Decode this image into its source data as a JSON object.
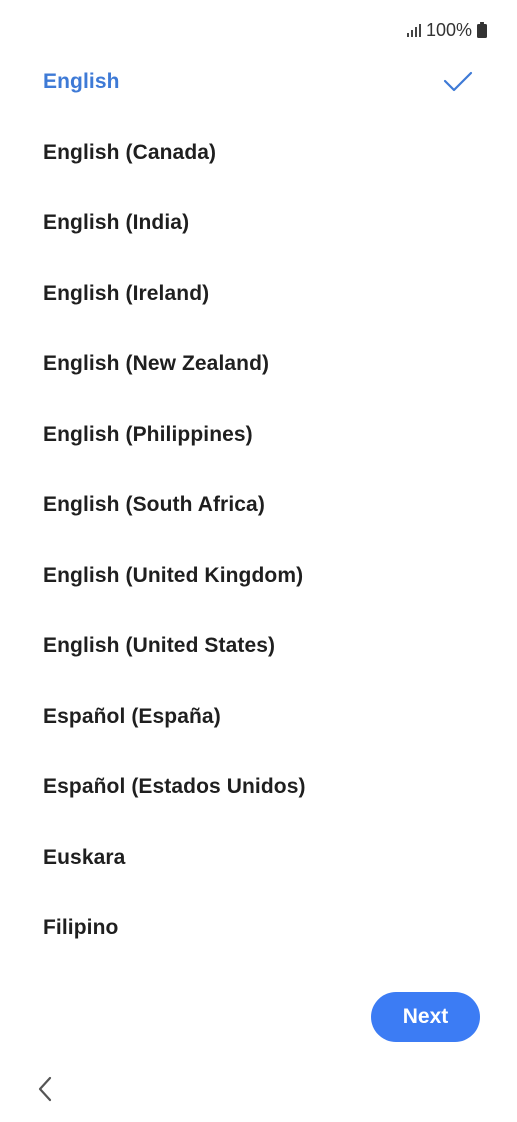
{
  "status_bar": {
    "signal_icon": "signal-bars-icon",
    "battery_text": "100%",
    "battery_icon": "battery-full-icon"
  },
  "languages": [
    {
      "label": "English",
      "selected": true
    },
    {
      "label": "English (Canada)",
      "selected": false
    },
    {
      "label": "English (India)",
      "selected": false
    },
    {
      "label": "English (Ireland)",
      "selected": false
    },
    {
      "label": "English (New Zealand)",
      "selected": false
    },
    {
      "label": "English (Philippines)",
      "selected": false
    },
    {
      "label": "English (South Africa)",
      "selected": false
    },
    {
      "label": "English (United Kingdom)",
      "selected": false
    },
    {
      "label": "English (United States)",
      "selected": false
    },
    {
      "label": "Español (España)",
      "selected": false
    },
    {
      "label": "Español (Estados Unidos)",
      "selected": false
    },
    {
      "label": "Euskara",
      "selected": false
    },
    {
      "label": "Filipino",
      "selected": false
    }
  ],
  "selected_check_icon": "checkmark-icon",
  "next_button": {
    "label": "Next"
  },
  "back_icon": "chevron-left-icon",
  "colors": {
    "accent": "#3e7ad6",
    "button": "#3c7cf4",
    "text": "#1f1f1f",
    "background": "#ffffff"
  }
}
